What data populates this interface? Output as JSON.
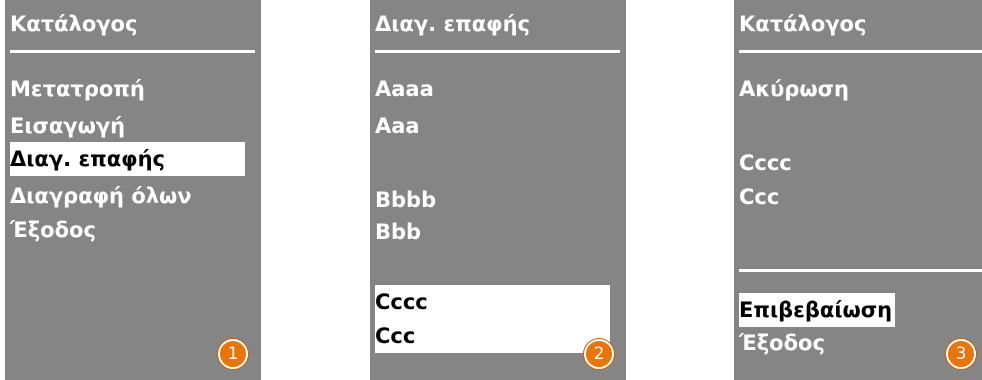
{
  "screens": [
    {
      "title": "Κατάλογος",
      "items": [
        "Μετατροπή",
        "Εισαγωγή",
        "Διαγ. επαφής",
        "Διαγραφή όλων",
        "Έξοδος"
      ],
      "selected_index": 2,
      "step": "1"
    },
    {
      "title": "Διαγ. επαφής",
      "items": [
        "Aaaa",
        "Aaa",
        "Bbbb",
        "Bbb",
        "Cccc",
        "Ccc"
      ],
      "selected_index": 4,
      "step": "2"
    },
    {
      "title": "Κατάλογος",
      "items": [
        "Ακύρωση",
        "Cccc",
        "Ccc",
        "Επιβεβαίωση",
        "Έξοδος"
      ],
      "selected_index": 3,
      "step": "3"
    }
  ],
  "colors": {
    "screen_bg": "#858585",
    "text": "#ffffff",
    "selection_bg": "#ffffff",
    "selection_text": "#000000",
    "step_badge": "#e8740c"
  }
}
